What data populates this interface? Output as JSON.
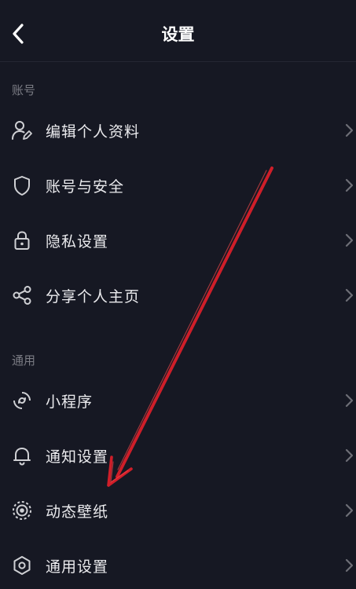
{
  "header": {
    "title": "设置"
  },
  "sections": [
    {
      "label": "账号",
      "items": [
        {
          "label": "编辑个人资料",
          "icon": "user-edit-icon"
        },
        {
          "label": "账号与安全",
          "icon": "shield-icon"
        },
        {
          "label": "隐私设置",
          "icon": "lock-icon"
        },
        {
          "label": "分享个人主页",
          "icon": "share-icon"
        }
      ]
    },
    {
      "label": "通用",
      "items": [
        {
          "label": "小程序",
          "icon": "mini-program-icon"
        },
        {
          "label": "通知设置",
          "icon": "bell-icon"
        },
        {
          "label": "动态壁纸",
          "icon": "wallpaper-icon"
        },
        {
          "label": "通用设置",
          "icon": "hexagon-gear-icon"
        }
      ]
    }
  ],
  "colors": {
    "background": "#161823",
    "text": "#ebebee",
    "muted": "#7b7c84",
    "annotation_arrow": "#e0202a"
  }
}
